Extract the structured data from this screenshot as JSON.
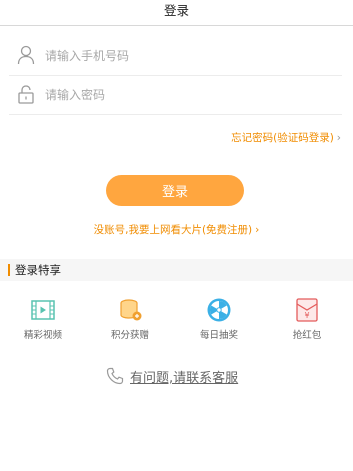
{
  "header": {
    "title": "登录"
  },
  "form": {
    "phone_placeholder": "请输入手机号码",
    "password_placeholder": "请输入密码",
    "forgot_link": "忘记密码(验证码登录)",
    "login_button": "登录",
    "register_link": "没账号,我要上网看大片(免费注册)"
  },
  "perks": {
    "title": "登录特享",
    "items": [
      {
        "label": "精彩视频",
        "icon": "film-icon"
      },
      {
        "label": "积分获赠",
        "icon": "coins-icon"
      },
      {
        "label": "每日抽奖",
        "icon": "lottery-wheel-icon"
      },
      {
        "label": "抢红包",
        "icon": "red-envelope-icon"
      }
    ]
  },
  "service": {
    "text": "有问题,请联系客服",
    "icon": "phone-icon"
  },
  "colors": {
    "accent": "#f08c00",
    "button": "#ffa63f",
    "teal": "#59c3b0",
    "sky": "#3bb0e6",
    "red": "#e45c5c"
  }
}
